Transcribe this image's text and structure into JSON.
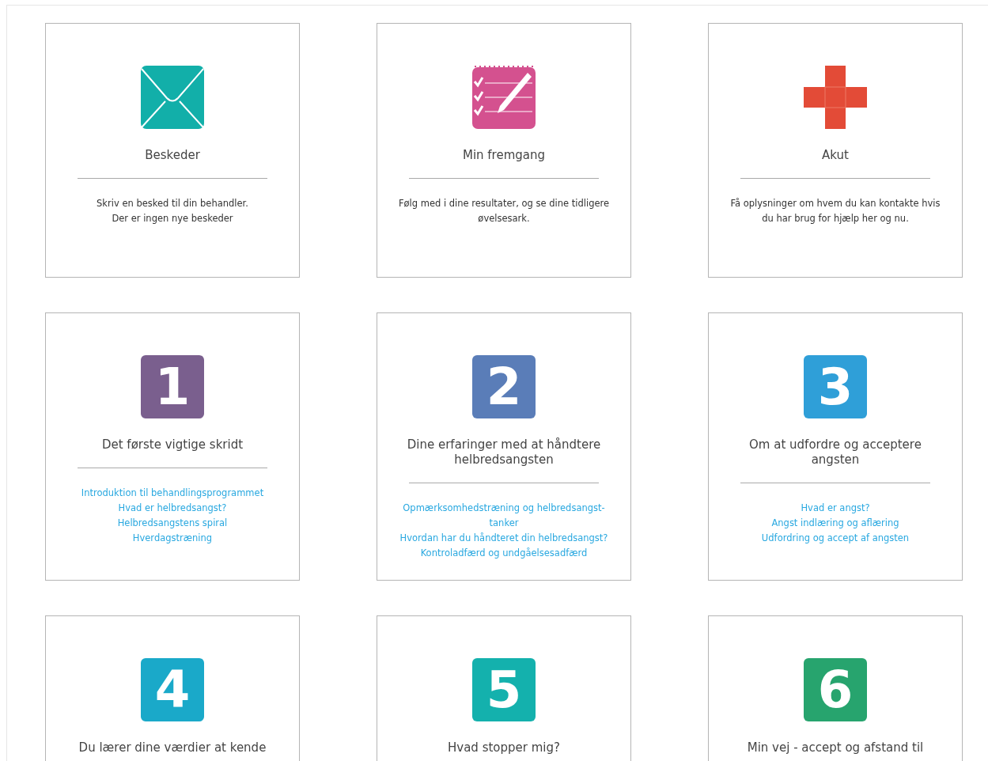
{
  "cards": [
    {
      "kind": "messages",
      "title": "Beskeder",
      "description": [
        "Skriv en besked til din behandler.",
        "Der er ingen nye beskeder"
      ]
    },
    {
      "kind": "progress",
      "title": "Min fremgang",
      "description": [
        "Følg med i dine resultater, og se dine tidligere øvelsesark."
      ]
    },
    {
      "kind": "emergency",
      "title": "Akut",
      "description": [
        "Få oplysninger om hvem du kan kontakte hvis du har brug for hjælp her og nu."
      ]
    },
    {
      "kind": "module",
      "number": "1",
      "color": "#7a5f8e",
      "title": "Det første vigtige skridt",
      "links": [
        "Introduktion til behandlingsprogrammet",
        "Hvad er helbredsangst?",
        "Helbredsangstens spiral",
        "Hverdagstræning"
      ]
    },
    {
      "kind": "module",
      "number": "2",
      "color": "#5a7db8",
      "title": "Dine erfaringer med at håndtere helbredsangsten",
      "links": [
        "Opmærksomhedstræning og helbredsangst-tanker",
        "Hvordan har du håndteret din helbredsangst?",
        "Kontroladfærd og undgåelsesadfærd"
      ]
    },
    {
      "kind": "module",
      "number": "3",
      "color": "#2f9fd8",
      "title": "Om at udfordre og acceptere angsten",
      "links": [
        "Hvad er angst?",
        "Angst indlæring og aflæring",
        "Udfordring og accept af angsten"
      ]
    },
    {
      "kind": "module",
      "number": "4",
      "color": "#1aa9c9",
      "title": "Du lærer dine værdier at kende"
    },
    {
      "kind": "module",
      "number": "5",
      "color": "#14b1ad",
      "title": "Hvad stopper mig?"
    },
    {
      "kind": "module",
      "number": "6",
      "color": "#27a46e",
      "title": "Min vej - accept og afstand til"
    }
  ]
}
